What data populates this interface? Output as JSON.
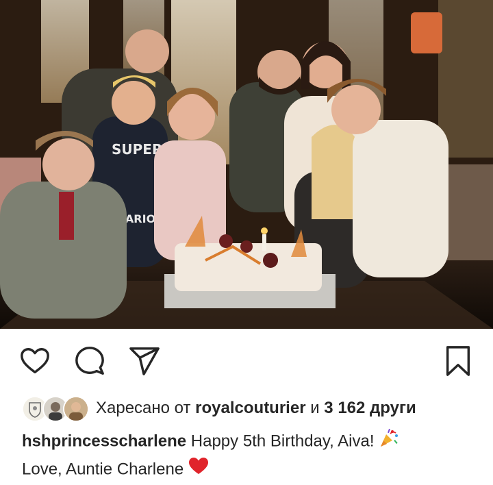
{
  "post": {
    "image_alt": "",
    "liked_by": {
      "prefix": "Харесано от",
      "user": "royalcouturier",
      "connector": "и",
      "count_text": "3 162 други"
    },
    "caption": {
      "username": "hshprincesscharlene",
      "line1": "Happy 5th Birthday, Aiva!",
      "line2": "Love, Auntie Charlene"
    }
  },
  "icons": {
    "like": "heart-outline-icon",
    "comment": "speech-bubble-icon",
    "share": "paper-plane-icon",
    "save": "bookmark-icon",
    "party": "party-popper-icon",
    "heart": "red-heart-icon"
  },
  "colors": {
    "text": "#262626",
    "heart": "#e0242b"
  }
}
